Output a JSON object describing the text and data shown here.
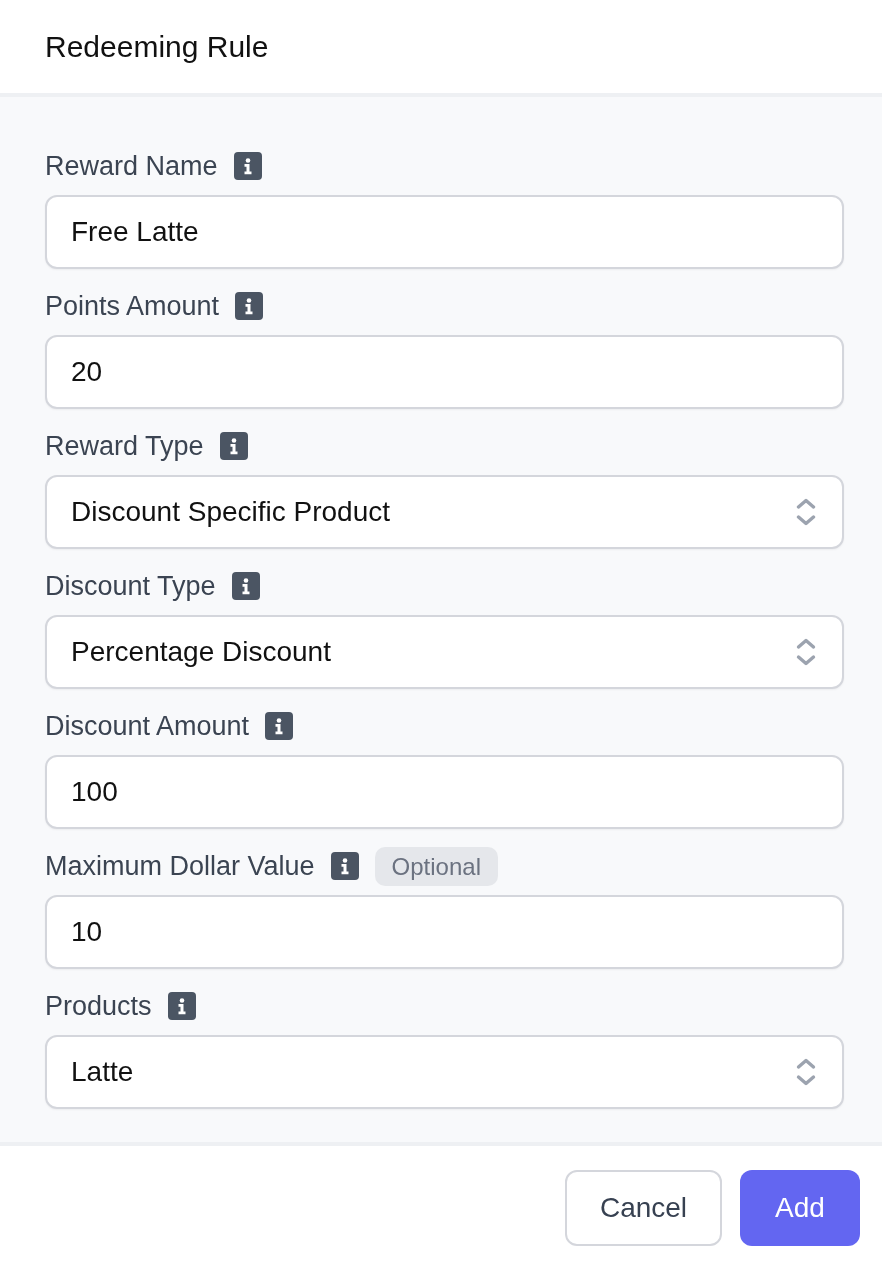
{
  "dialog": {
    "title": "Redeeming Rule"
  },
  "fields": [
    {
      "label": "Reward Name",
      "kind": "text",
      "value": "Free Latte"
    },
    {
      "label": "Points Amount",
      "kind": "text",
      "value": "20"
    },
    {
      "label": "Reward Type",
      "kind": "select",
      "value": "Discount Specific Product"
    },
    {
      "label": "Discount Type",
      "kind": "select",
      "value": "Percentage Discount"
    },
    {
      "label": "Discount Amount",
      "kind": "text",
      "value": "100"
    },
    {
      "label": "Maximum Dollar Value",
      "kind": "text",
      "value": "10",
      "badge": "Optional"
    },
    {
      "label": "Products",
      "kind": "select",
      "value": "Latte"
    }
  ],
  "buttons": [
    {
      "label": "Cancel",
      "kind": "secondary"
    },
    {
      "label": "Add",
      "kind": "primary"
    }
  ]
}
